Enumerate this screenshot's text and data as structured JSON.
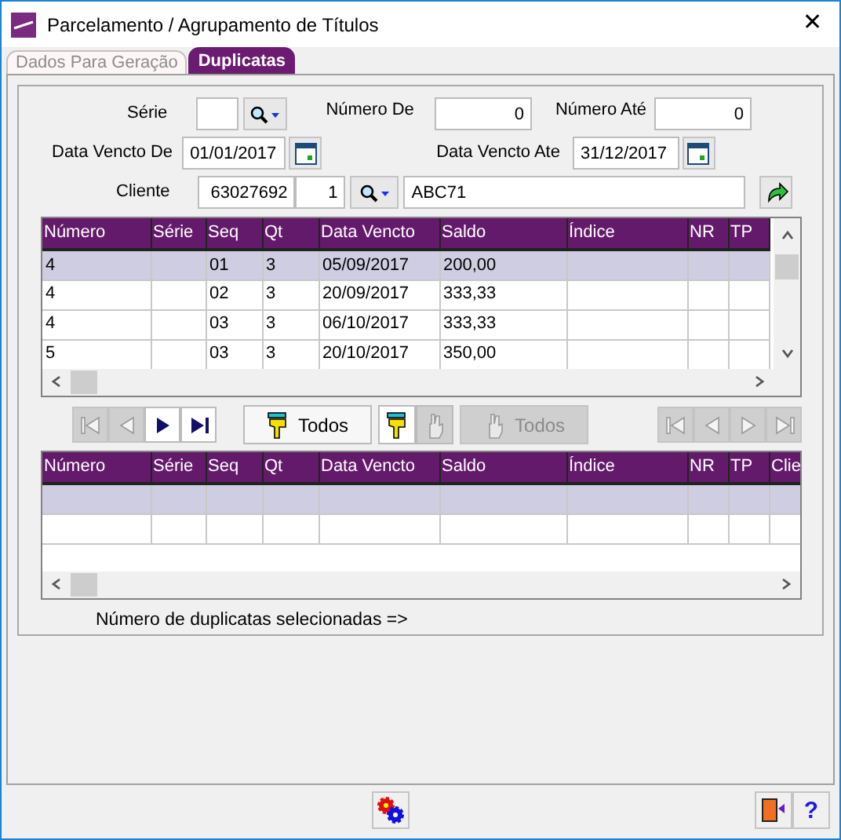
{
  "window": {
    "title": "Parcelamento / Agrupamento de Títulos",
    "close": "✕"
  },
  "tabs": [
    {
      "label": "Dados Para Geração",
      "selected": false
    },
    {
      "label": "Duplicatas",
      "selected": true
    }
  ],
  "filters": {
    "serie_label": "Série",
    "numero_de_label": "Número De",
    "numero_de": "0",
    "numero_ate_label": "Número Até",
    "numero_ate": "0",
    "data_de_label": "Data Vencto De",
    "data_de": "01/01/2017",
    "data_ate_label": "Data Vencto Ate",
    "data_ate": "31/12/2017",
    "cliente_label": "Cliente",
    "cliente_codigo": "63027692",
    "cliente_loja": "1",
    "cliente_nome": "ABC71"
  },
  "grid_top": {
    "columns": [
      "Número",
      "Série",
      "Seq",
      "Qt",
      "Data Vencto",
      "Saldo",
      "Índice",
      "NR",
      "TP"
    ],
    "rows": [
      {
        "cells": [
          "4",
          "",
          "01",
          "3",
          "05/09/2017",
          "200,00",
          "",
          "",
          ""
        ],
        "selected": true
      },
      {
        "cells": [
          "4",
          "",
          "02",
          "3",
          "20/09/2017",
          "333,33",
          "",
          "",
          ""
        ],
        "selected": false
      },
      {
        "cells": [
          "4",
          "",
          "03",
          "3",
          "06/10/2017",
          "333,33",
          "",
          "",
          ""
        ],
        "selected": false
      },
      {
        "cells": [
          "5",
          "",
          "03",
          "3",
          "20/10/2017",
          "350,00",
          "",
          "",
          ""
        ],
        "selected": false
      }
    ]
  },
  "nav_left": [
    {
      "kind": "first",
      "disabled": true
    },
    {
      "kind": "prev",
      "disabled": true
    },
    {
      "kind": "next",
      "disabled": false
    },
    {
      "kind": "last",
      "disabled": false
    }
  ],
  "mark_buttons": [
    {
      "kind": "mark-all",
      "label": "Todos",
      "disabled": false
    },
    {
      "kind": "mark",
      "disabled": false
    },
    {
      "kind": "unmark",
      "disabled": true
    },
    {
      "kind": "unmark-all",
      "label": "Todos",
      "disabled": true
    }
  ],
  "nav_right": [
    {
      "kind": "first",
      "disabled": true
    },
    {
      "kind": "prev",
      "disabled": true
    },
    {
      "kind": "next",
      "disabled": true
    },
    {
      "kind": "last",
      "disabled": true
    }
  ],
  "grid_bottom": {
    "columns": [
      "Número",
      "Série",
      "Seq",
      "Qt",
      "Data Vencto",
      "Saldo",
      "Índice",
      "NR",
      "TP",
      "Clie"
    ],
    "rows": [
      {
        "selected": true
      }
    ]
  },
  "selected_count_label": "Número de duplicatas selecionadas =>",
  "help_button": "?"
}
